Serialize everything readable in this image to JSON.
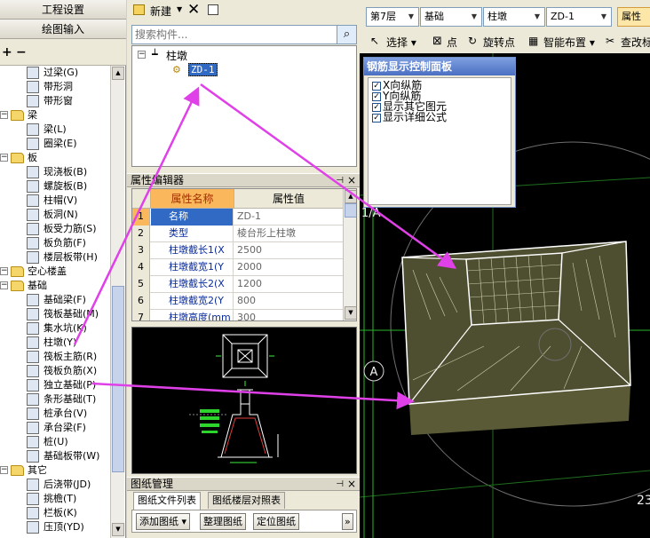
{
  "left_nav": {
    "project_settings": "工程设置",
    "drawing_input": "绘图输入",
    "add_icon": "plus-icon",
    "remove_icon": "minus-icon",
    "tree": [
      {
        "label": "过梁(G)",
        "level": 1
      },
      {
        "label": "带形洞",
        "level": 1
      },
      {
        "label": "带形窗",
        "level": 1
      },
      {
        "label": "梁",
        "level": 0
      },
      {
        "label": "梁(L)",
        "level": 1
      },
      {
        "label": "圈梁(E)",
        "level": 1
      },
      {
        "label": "板",
        "level": 0
      },
      {
        "label": "现浇板(B)",
        "level": 1
      },
      {
        "label": "螺旋板(B)",
        "level": 1
      },
      {
        "label": "柱帽(V)",
        "level": 1
      },
      {
        "label": "板洞(N)",
        "level": 1
      },
      {
        "label": "板受力筋(S)",
        "level": 1
      },
      {
        "label": "板负筋(F)",
        "level": 1
      },
      {
        "label": "楼层板带(H)",
        "level": 1
      },
      {
        "label": "空心楼盖",
        "level": 0
      },
      {
        "label": "基础",
        "level": 0
      },
      {
        "label": "基础梁(F)",
        "level": 1
      },
      {
        "label": "筏板基础(M)",
        "level": 1
      },
      {
        "label": "集水坑(K)",
        "level": 1
      },
      {
        "label": "柱墩(Y)",
        "level": 1
      },
      {
        "label": "筏板主筋(R)",
        "level": 1
      },
      {
        "label": "筏板负筋(X)",
        "level": 1
      },
      {
        "label": "独立基础(P)",
        "level": 1
      },
      {
        "label": "条形基础(T)",
        "level": 1
      },
      {
        "label": "桩承台(V)",
        "level": 1
      },
      {
        "label": "承台梁(F)",
        "level": 1
      },
      {
        "label": "桩(U)",
        "level": 1
      },
      {
        "label": "基础板带(W)",
        "level": 1
      },
      {
        "label": "其它",
        "level": 0
      },
      {
        "label": "后浇带(JD)",
        "level": 1
      },
      {
        "label": "挑檐(T)",
        "level": 1
      },
      {
        "label": "栏板(K)",
        "level": 1
      },
      {
        "label": "压顶(YD)",
        "level": 1
      }
    ]
  },
  "construct_list": {
    "new_label": "新建",
    "search_placeholder": "搜索构件...",
    "category": "柱墩",
    "item": "ZD-1"
  },
  "property_editor": {
    "title": "属性编辑器",
    "col_name": "属性名称",
    "col_value": "属性值",
    "rows": [
      {
        "n": "1",
        "k": "名称",
        "v": "ZD-1"
      },
      {
        "n": "2",
        "k": "类型",
        "v": "棱台形上柱墩"
      },
      {
        "n": "3",
        "k": "柱墩截长1(X",
        "v": "2500"
      },
      {
        "n": "4",
        "k": "柱墩截宽1(Y",
        "v": "2000"
      },
      {
        "n": "5",
        "k": "柱墩截长2(X",
        "v": "1200"
      },
      {
        "n": "6",
        "k": "柱墩截宽2(Y",
        "v": "800"
      },
      {
        "n": "7",
        "k": "柱墩高度(mm",
        "v": "300"
      }
    ]
  },
  "drawing_manager": {
    "title": "图纸管理",
    "tab_files": "图纸文件列表",
    "tab_floors": "图纸楼层对照表",
    "add_drawing": "添加图纸",
    "organize": "整理图纸",
    "locate": "定位图纸",
    "more": "»"
  },
  "main_toolbar": {
    "floor": "第7层",
    "type": "基础",
    "component": "柱墩",
    "instance": "ZD-1",
    "properties": "属性",
    "select": "选择",
    "point": "点",
    "rotate_point": "旋转点",
    "smart_layout": "智能布置",
    "check": "查改标"
  },
  "rebar_panel": {
    "title": "钢筋显示控制面板",
    "options": [
      "X向纵筋",
      "Y向纵筋",
      "显示其它图元",
      "显示详细公式"
    ]
  },
  "canvas": {
    "axis_a": "A",
    "axis_1a": "1/A",
    "coord": "23"
  },
  "colors": {
    "arrow": "#e040e8",
    "slab_fill": "#5c5c3a",
    "grid_line": "#ffffff",
    "selection": "#316ac5"
  }
}
